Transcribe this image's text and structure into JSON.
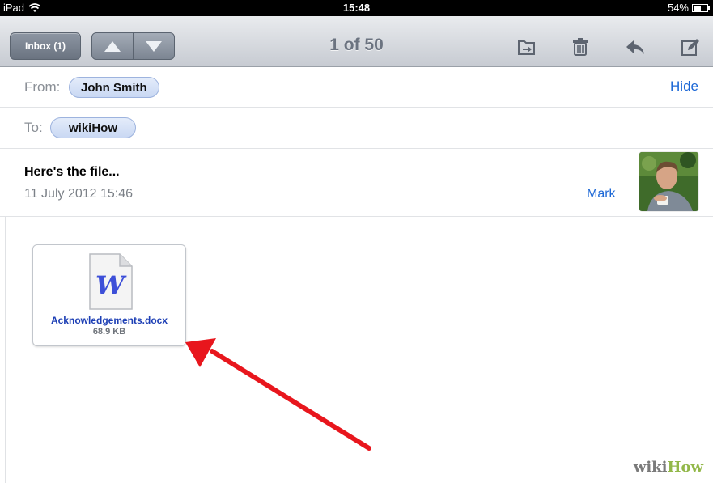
{
  "status_bar": {
    "device": "iPad",
    "time": "15:48",
    "battery": "54%",
    "battery_level": 0.54
  },
  "toolbar": {
    "inbox_label": "Inbox (1)",
    "counter": "1 of 50",
    "icons": [
      "move-folder-icon",
      "trash-icon",
      "reply-icon",
      "compose-icon"
    ]
  },
  "message": {
    "from_label": "From:",
    "from_name": "John Smith",
    "hide_label": "Hide",
    "to_label": "To:",
    "to_name": "wikiHow",
    "subject": "Here's the file...",
    "date": "11 July 2012 15:46",
    "mark_label": "Mark"
  },
  "attachment": {
    "icon_letter": "W",
    "filename": "Acknowledgements.docx",
    "size": "68.9 KB"
  },
  "watermark": {
    "wiki": "wiki",
    "how": "How"
  },
  "colors": {
    "link": "#1d68d6",
    "arrow": "#e8161d",
    "attachment_name": "#1d3fb5"
  }
}
